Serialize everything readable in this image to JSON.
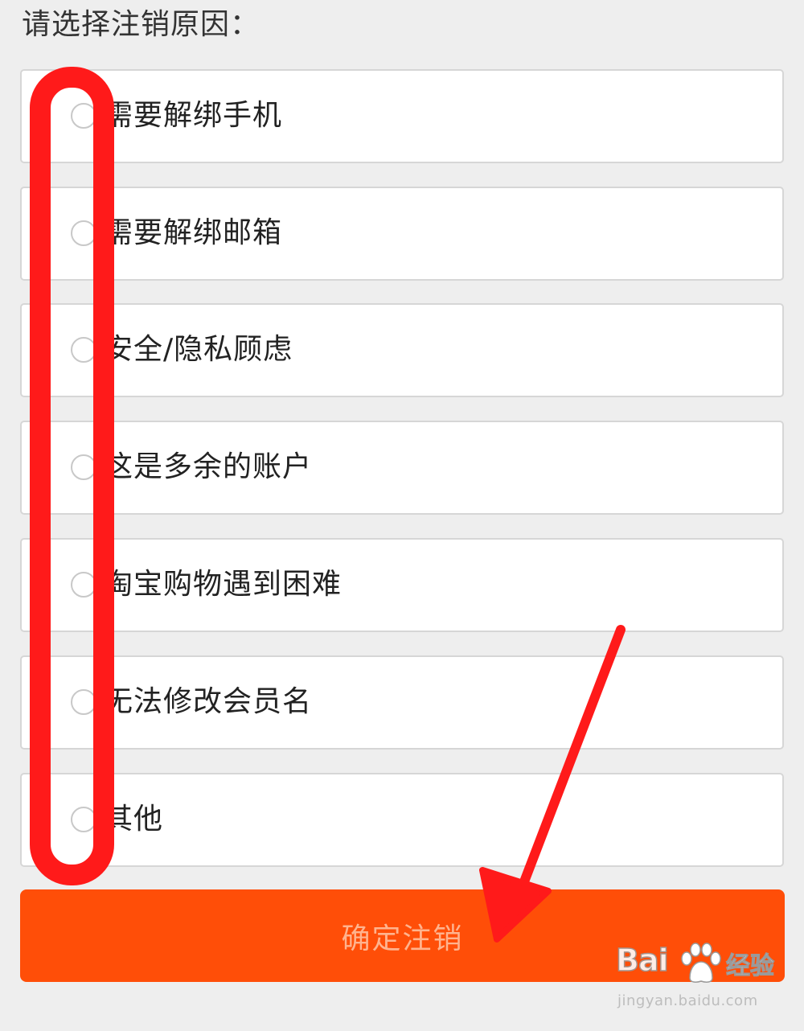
{
  "page": {
    "title": "请选择注销原因："
  },
  "reasons": [
    {
      "label": "需要解绑手机"
    },
    {
      "label": "需要解绑邮箱"
    },
    {
      "label": "安全/隐私顾虑"
    },
    {
      "label": "这是多余的账户"
    },
    {
      "label": "淘宝购物遇到困难"
    },
    {
      "label": "无法修改会员名"
    },
    {
      "label": "其他"
    }
  ],
  "actions": {
    "confirm_label": "确定注销"
  },
  "watermark": {
    "logo_text": "Bai",
    "brand_text": "经验",
    "url": "jingyan.baidu.com"
  },
  "colors": {
    "background": "#eeeeee",
    "confirm_button": "#ff4e08",
    "confirm_text": "#ffb38e",
    "annotation_red": "#ff1a1a"
  }
}
